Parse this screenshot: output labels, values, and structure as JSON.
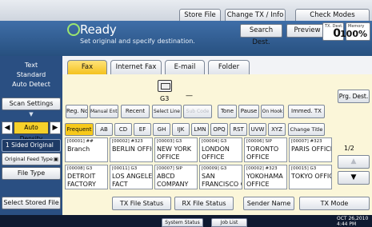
{
  "top": {
    "store_file": "Store File",
    "change_tx_info": "Change TX / Info",
    "check_modes": "Check Modes"
  },
  "status": {
    "text": "Ready",
    "subtitle": "Set original and specify destination.",
    "search_dest": "Search Dest.",
    "preview": "Preview",
    "tx_label": "TX. Dest.",
    "tx_value": "0",
    "memory_label": "Memory",
    "memory_value": "100%"
  },
  "left": {
    "mode1": "Text",
    "mode2": "Standard",
    "mode3": "Auto Detect",
    "scan_settings": "Scan Settings",
    "density": "Auto Density",
    "sided": "1 Sided Original",
    "feed_type": "Original Feed Type",
    "file_type": "File Type",
    "select_stored": "Select Stored File"
  },
  "tabs": [
    "Fax",
    "Internet Fax",
    "E-mail",
    "Folder"
  ],
  "line": {
    "g3": "G3",
    "dash": "—",
    "prg": "Prg. Dest."
  },
  "options": [
    "Reg. No.",
    "Manual Entry",
    "Recent",
    "Select Line",
    "Sub Code",
    "Tone",
    "Pause",
    "On Hook",
    "Immed. TX"
  ],
  "index": [
    "Frequent",
    "AB",
    "CD",
    "EF",
    "GH",
    "IJK",
    "LMN",
    "OPQ",
    "RST",
    "UVW",
    "XYZ",
    "Change Title"
  ],
  "destinations": [
    {
      "code": "[00001] ##",
      "name": "Branch"
    },
    {
      "code": "[00002] #323",
      "name": "BERLIN OFFICE"
    },
    {
      "code": "[00003] G3",
      "name": "NEW YORK OFFICE"
    },
    {
      "code": "[00004] G3",
      "name": "LONDON OFFICE"
    },
    {
      "code": "[00006] SIP",
      "name": "TORONTO OFFICE"
    },
    {
      "code": "[00007] #323",
      "name": "PARIS OFFICE"
    },
    {
      "code": "[00008] G3",
      "name": "DETROIT FACTORY"
    },
    {
      "code": "[00011] G3",
      "name": "LOS ANGELES FACT"
    },
    {
      "code": "[00007] SIP",
      "name": "ABCD COMPANY"
    },
    {
      "code": "[00009] G3",
      "name": "SAN FRANCISCO OF"
    },
    {
      "code": "[00002] #323",
      "name": "YOKOHAMA OFFICE"
    },
    {
      "code": "[00015] G3",
      "name": "TOKYO OFFICE"
    }
  ],
  "page": {
    "indicator": "1/2",
    "up": "▲",
    "down": "▼"
  },
  "bottom": {
    "tx_file_status": "TX File Status",
    "rx_file_status": "RX File Status",
    "sender_name": "Sender Name",
    "tx_mode": "TX Mode"
  },
  "footer": {
    "system_status": "System Status",
    "job_list": "Job List",
    "date": "OCT  26,2010",
    "time": "4:44 PM"
  }
}
